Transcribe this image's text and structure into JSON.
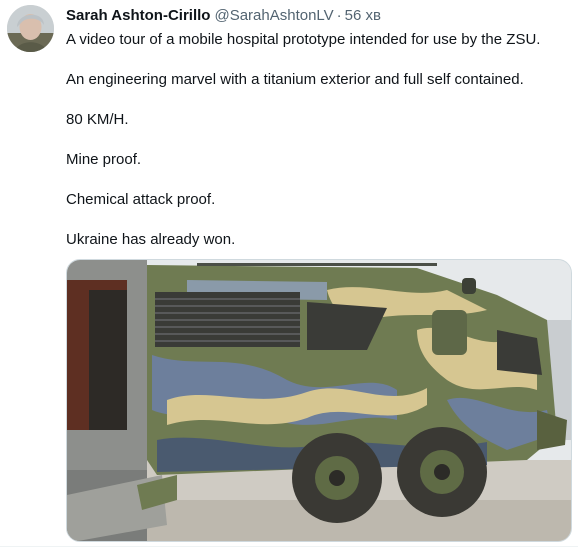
{
  "tweet": {
    "author_name": "Sarah Ashton-Cirillo",
    "author_handle": "@SarahAshtonLV",
    "separator": "·",
    "time": "56 хв",
    "paragraphs": [
      "A video tour of a mobile hospital prototype intended for use by the ZSU.",
      "An engineering marvel with a titanium exterior and full self contained.",
      "80 KM/H.",
      "Mine proof.",
      "Chemical attack proof.",
      "Ukraine has already won."
    ]
  },
  "colors": {
    "name": "#0f1419",
    "secondary": "#536471",
    "camo_green": "#6f7b52",
    "camo_blue": "#6d7f9c",
    "camo_tan": "#d6c691"
  }
}
